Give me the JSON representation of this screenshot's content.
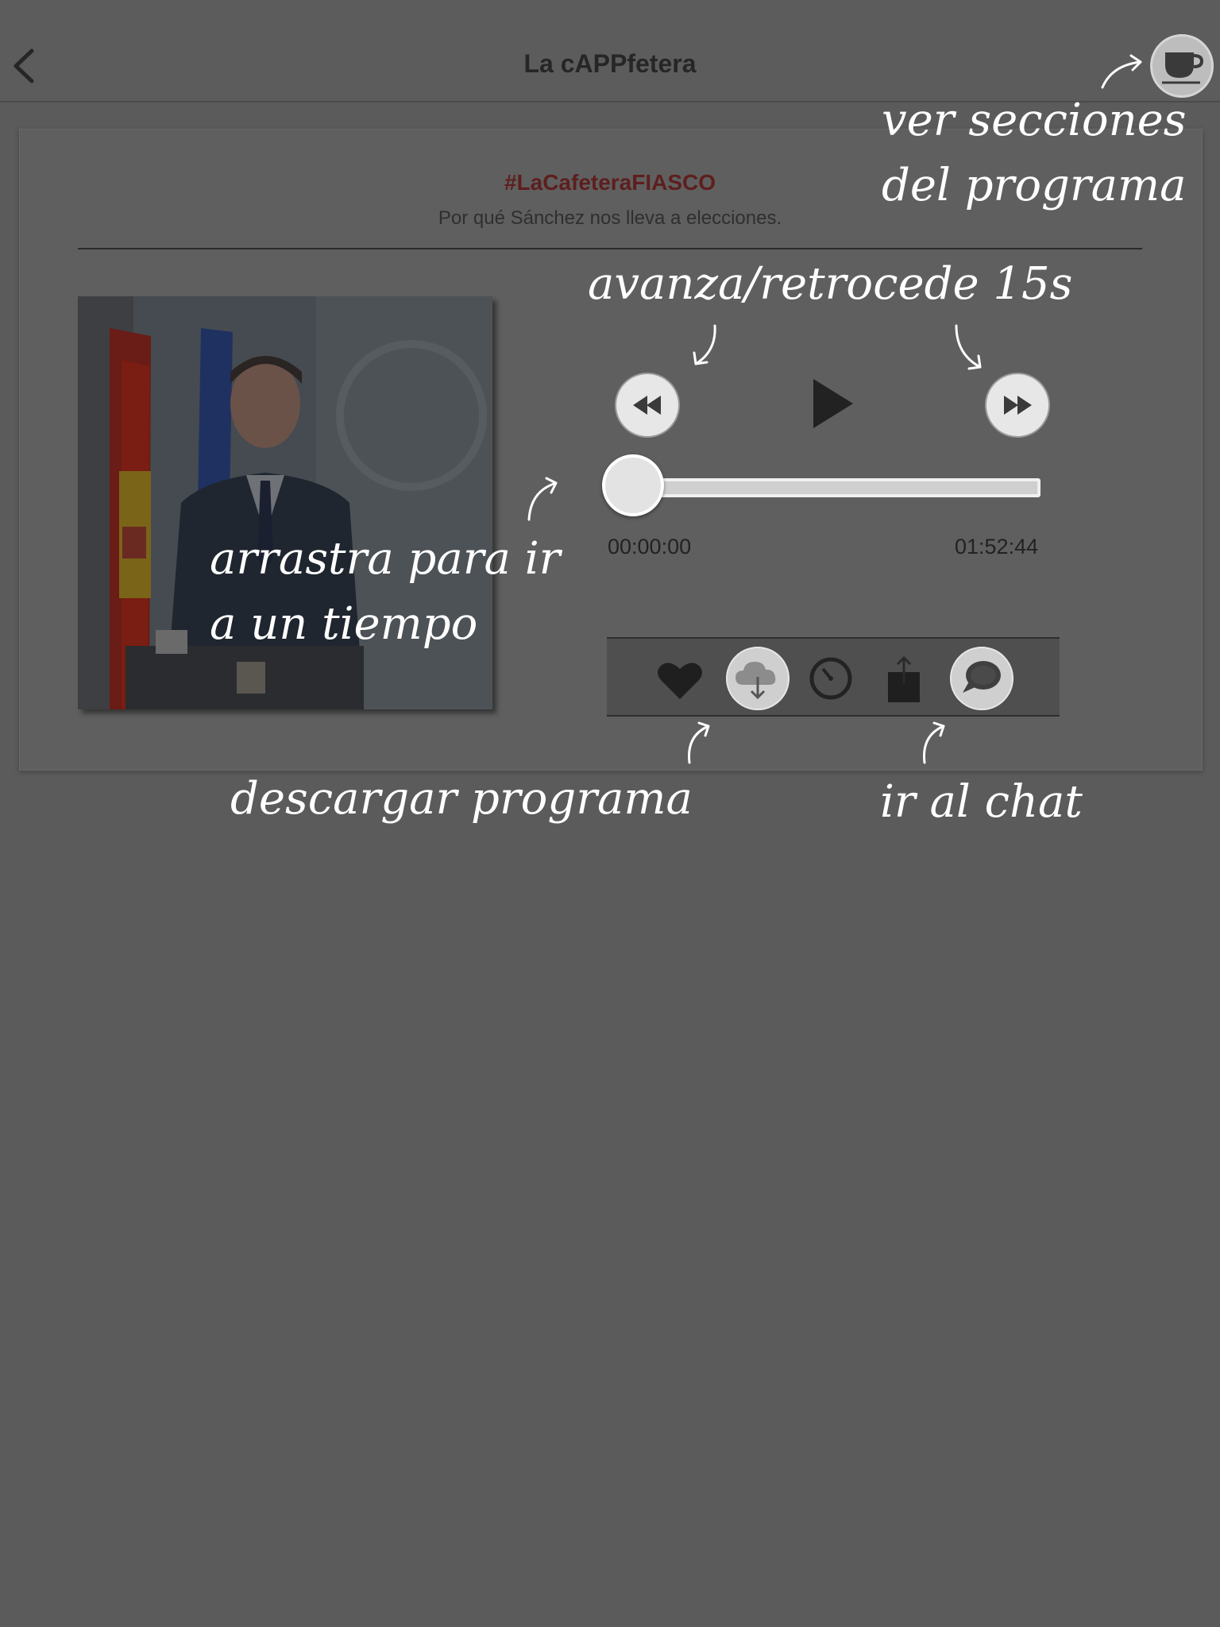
{
  "navbar": {
    "title": "La cAPPfetera",
    "back_icon": "chevron-left-icon",
    "sections_icon": "coffee-cup-icon"
  },
  "episode": {
    "title": "#LaCafeteraFIASCO",
    "subtitle": "Por qué Sánchez nos lleva a elecciones."
  },
  "player": {
    "elapsed": "00:00:00",
    "duration": "01:52:44",
    "progress": 0,
    "rewind_icon": "rewind-icon",
    "play_icon": "play-icon",
    "forward_icon": "fast-forward-icon"
  },
  "toolbar": {
    "icons": [
      "heart-icon",
      "cloud-download-icon",
      "timer-icon",
      "share-icon",
      "chat-bubble-icon"
    ]
  },
  "annotations": {
    "sections": [
      "ver secciones",
      "del programa"
    ],
    "skip": "avanza/retrocede 15s",
    "drag": [
      "arrastra para ir",
      "a un tiempo"
    ],
    "download": "descargar programa",
    "chat": "ir al chat"
  },
  "colors": {
    "overlay_background": "#5b5b5b",
    "hashtag": "#5e1e1e",
    "annotation_text": "#ffffff"
  }
}
